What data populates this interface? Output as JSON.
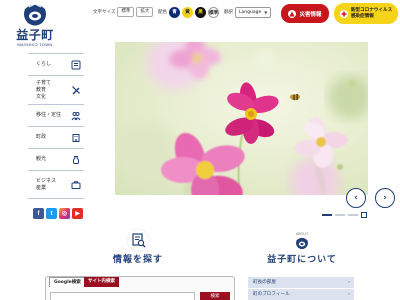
{
  "logo": {
    "name": "益子町",
    "sub": "MASHIKO TOWN"
  },
  "header": {
    "font_size_label": "文字サイズ",
    "font_standard": "標準",
    "font_large": "拡大",
    "color_label": "配色",
    "color_options": [
      "青",
      "黄",
      "黒"
    ],
    "color_standard": "標準",
    "lang_label": "翻訳",
    "language": "Language",
    "disaster_button": "災害情報",
    "covid_button_line1": "新型コロナウイルス",
    "covid_button_line2": "感染症情報"
  },
  "nav": {
    "items": [
      {
        "label": "くらし",
        "icon": "book-icon"
      },
      {
        "label": "子育て\n教育\n文化",
        "icon": "pencil-icon"
      },
      {
        "label": "移住・定住",
        "icon": "people-icon"
      },
      {
        "label": "町政",
        "icon": "building-icon"
      },
      {
        "label": "観光",
        "icon": "pot-icon"
      },
      {
        "label": "ビジネス\n産業",
        "icon": "briefcase-icon"
      }
    ]
  },
  "social": [
    "f",
    "t",
    "◎",
    "▶"
  ],
  "slider": {
    "prev": "‹",
    "next": "›",
    "dots": 3,
    "active_dot": 0
  },
  "search_section": {
    "title": "情報を探す",
    "sub": "Looking for information",
    "tab_google": "Google検索",
    "tab_site": "サイト内検索",
    "placeholder": "",
    "button": "検索"
  },
  "about_section": {
    "title": "益子町について",
    "sub": "ABOUT",
    "items": [
      "町長の部屋",
      "町のプロフィール"
    ]
  },
  "colors": {
    "brand_navy": "#1f3f78",
    "red": "#c8161d",
    "yellow": "#f5d41a",
    "maroon": "#9a1020"
  }
}
